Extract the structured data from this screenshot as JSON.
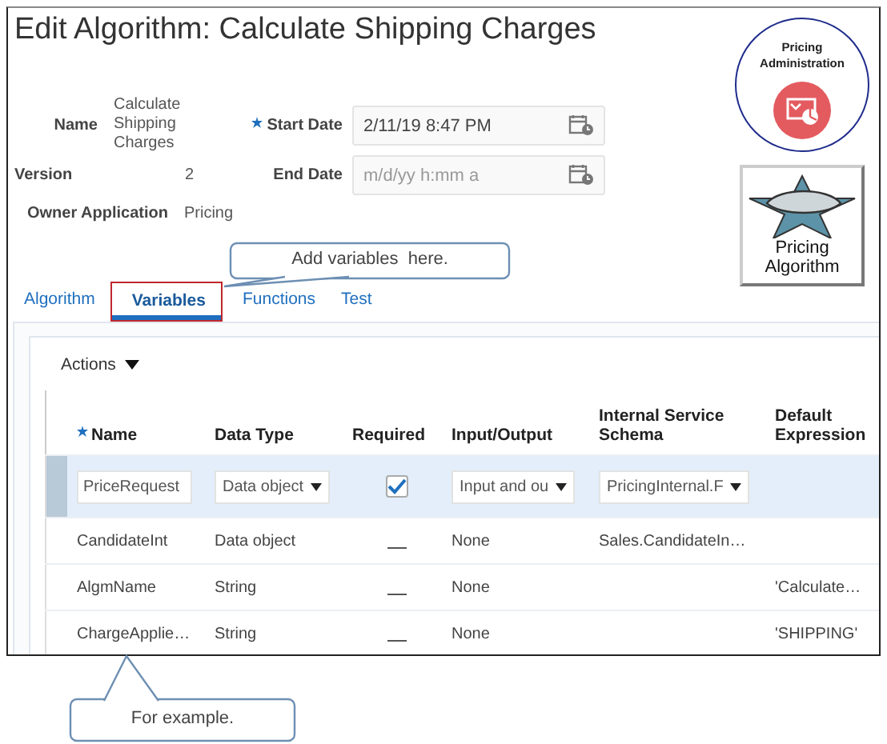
{
  "header": {
    "title": "Edit Algorithm: Calculate Shipping Charges"
  },
  "details": {
    "name": {
      "label": "Name",
      "value": "Calculate Shipping Charges"
    },
    "version": {
      "label": "Version",
      "value": "2"
    },
    "owner_application": {
      "label": "Owner Application",
      "value": "Pricing"
    }
  },
  "dates": [
    {
      "label": "Start Date",
      "required": true,
      "value": "2/11/19 8:47 PM"
    },
    {
      "label": "End Date",
      "placeholder": "m/d/yy h:mm a"
    }
  ],
  "badge": {
    "title": "Pricing Administration"
  },
  "tile": {
    "label": "Pricing Algorithm"
  },
  "tabs": [
    {
      "label": "Algorithm",
      "selected": false,
      "highlighted": false
    },
    {
      "label": "Variables",
      "selected": true,
      "highlighted": true
    },
    {
      "label": "Functions",
      "selected": false,
      "highlighted": false
    },
    {
      "label": "Test",
      "selected": false,
      "highlighted": false
    }
  ],
  "actions_menu": {
    "label": "Actions"
  },
  "table": {
    "columns": [
      {
        "label": "Name",
        "required": true
      },
      {
        "label": "Data Type",
        "required": false
      },
      {
        "label": "Required",
        "required": false
      },
      {
        "label": "Input/Output",
        "required": false
      },
      {
        "label": "Internal Service Schema",
        "required": false
      },
      {
        "label": "Default Expression",
        "required": false
      }
    ],
    "rows": [
      {
        "selected": true,
        "name": "PriceRequest",
        "data_type": "Data object",
        "required": true,
        "input_output": "Input and ou",
        "schema": "PricingInternal.F"
      },
      {
        "selected": false,
        "name": "CandidateInt",
        "data_type": "Data object",
        "required": false,
        "input_output": "None",
        "schema": "Sales.CandidateIn…"
      },
      {
        "selected": false,
        "name": "AlgmName",
        "data_type": "String",
        "required": false,
        "input_output": "None",
        "default_expression": "'Calculate…"
      },
      {
        "selected": false,
        "name": "ChargeApplie…",
        "data_type": "String",
        "required": false,
        "input_output": "None",
        "default_expression": "'SHIPPING'"
      }
    ]
  },
  "callouts": [
    {
      "text": "Add variables  here."
    },
    {
      "text": "For example."
    }
  ]
}
